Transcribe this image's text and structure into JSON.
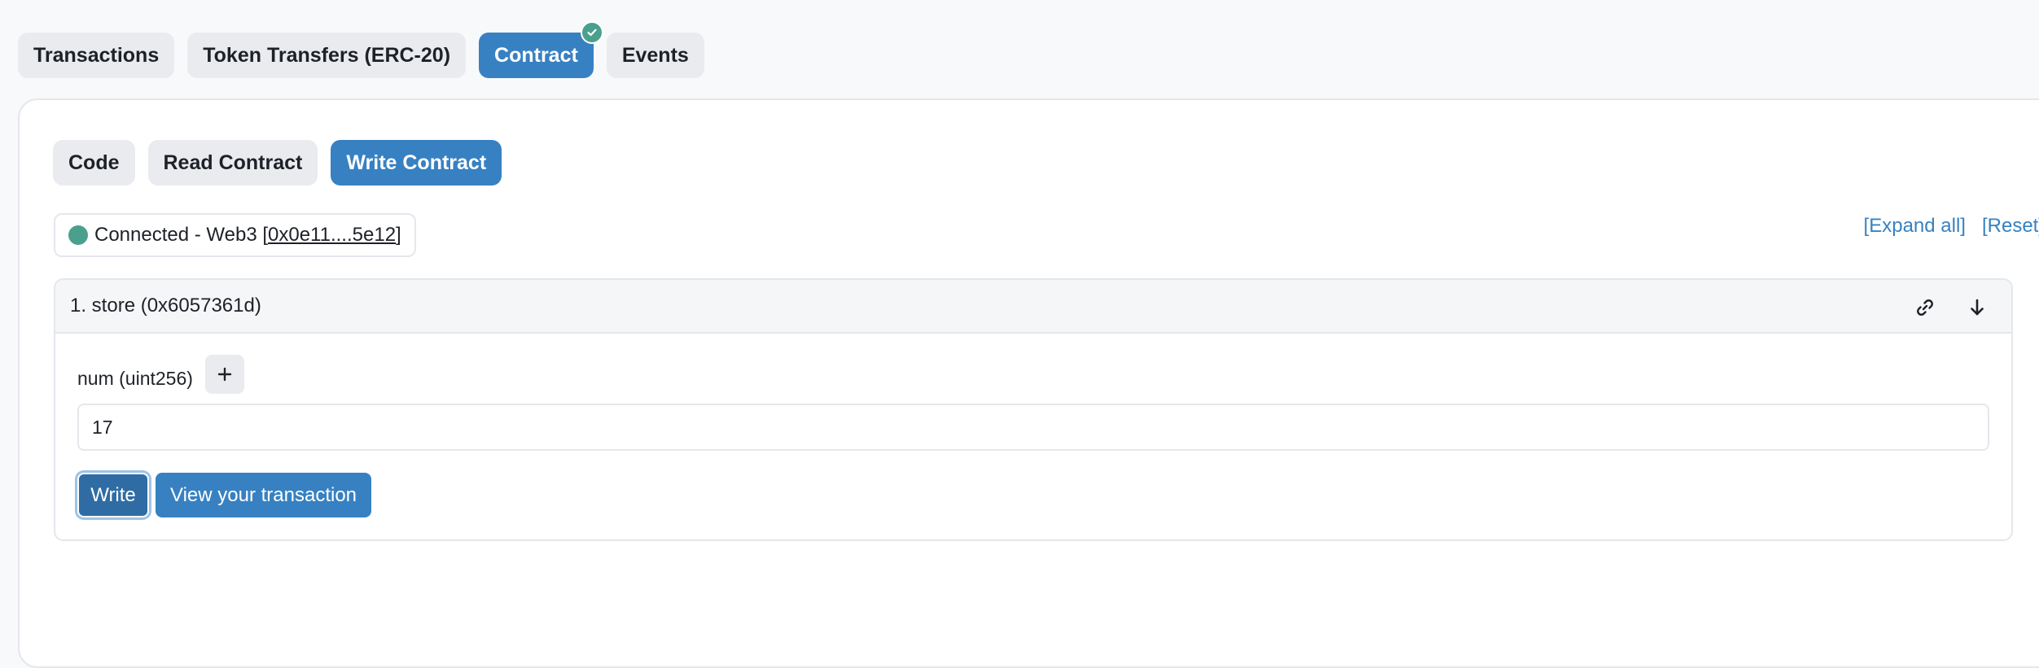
{
  "top_tabs": [
    {
      "label": "Transactions",
      "active": false
    },
    {
      "label": "Token Transfers (ERC-20)",
      "active": false
    },
    {
      "label": "Contract",
      "active": true,
      "verified_badge": "check-icon"
    },
    {
      "label": "Events",
      "active": false
    }
  ],
  "sub_tabs": [
    {
      "label": "Code",
      "active": false
    },
    {
      "label": "Read Contract",
      "active": false
    },
    {
      "label": "Write Contract",
      "active": true
    }
  ],
  "connection": {
    "prefix": "Connected - Web3 [",
    "address": "0x0e11....5e12",
    "suffix": "]",
    "status_color": "#4aa08d"
  },
  "links": {
    "expand_all": "[Expand all]",
    "reset": "[Reset]"
  },
  "function": {
    "title": "1. store (0x6057361d)",
    "param_label": "num (uint256)",
    "plus_label": "+",
    "input_value": "17",
    "write_label": "Write",
    "view_tx_label": "View your transaction",
    "icons": [
      "link-icon",
      "arrow-down-icon"
    ]
  },
  "colors": {
    "accent": "#3781c2",
    "success": "#4aa08d"
  }
}
